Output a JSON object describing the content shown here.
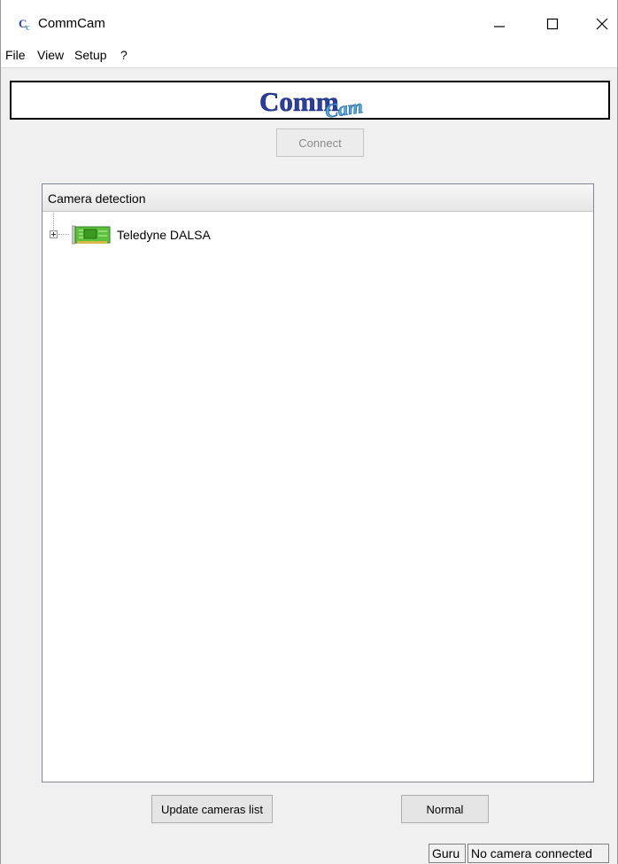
{
  "window": {
    "title": "CommCam",
    "app_icon": "commcam-app-icon",
    "controls": [
      "minimize-icon",
      "maximize-icon",
      "close-icon"
    ]
  },
  "menu": {
    "items": [
      "File",
      "View",
      "Setup",
      "?"
    ]
  },
  "logo": {
    "text_main": "Comm",
    "text_accent": "Cam"
  },
  "connect_button": {
    "label": "Connect",
    "enabled": false
  },
  "tree": {
    "header": "Camera detection",
    "items": [
      {
        "label": "Teledyne DALSA",
        "icon": "frame-grabber-card-icon",
        "expanded": false
      }
    ]
  },
  "bottom_buttons": {
    "update_label": "Update cameras list",
    "mode_label": "Normal"
  },
  "status_bar": {
    "mode": "Guru",
    "connection": "No camera connected"
  },
  "colors": {
    "window_bg": "#f0f0f0",
    "logo_primary": "#2b3f9e",
    "logo_accent": "#4fa6e0",
    "card_green": "#5cc23c"
  }
}
